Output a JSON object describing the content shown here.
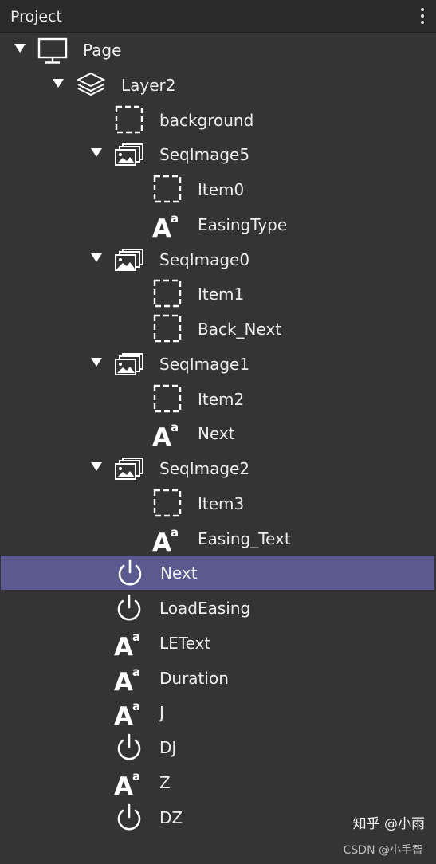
{
  "panel": {
    "title": "Project",
    "menu_icon": "more-vertical-icon"
  },
  "tree": [
    {
      "label": "Page",
      "icon": "monitor-icon",
      "depth": 0,
      "expanded": true
    },
    {
      "label": "Layer2",
      "icon": "layers-icon",
      "depth": 1,
      "expanded": true
    },
    {
      "label": "background",
      "icon": "dashed-box-icon",
      "depth": 2
    },
    {
      "label": "SeqImage5",
      "icon": "image-sequence-icon",
      "depth": 2,
      "expanded": true
    },
    {
      "label": "Item0",
      "icon": "dashed-box-icon",
      "depth": 3
    },
    {
      "label": "EasingType",
      "icon": "text-icon",
      "depth": 3
    },
    {
      "label": "SeqImage0",
      "icon": "image-sequence-icon",
      "depth": 2,
      "expanded": true
    },
    {
      "label": "Item1",
      "icon": "dashed-box-icon",
      "depth": 3
    },
    {
      "label": "Back_Next",
      "icon": "dashed-box-icon",
      "depth": 3
    },
    {
      "label": "SeqImage1",
      "icon": "image-sequence-icon",
      "depth": 2,
      "expanded": true
    },
    {
      "label": "Item2",
      "icon": "dashed-box-icon",
      "depth": 3
    },
    {
      "label": "Next",
      "icon": "text-icon",
      "depth": 3
    },
    {
      "label": "SeqImage2",
      "icon": "image-sequence-icon",
      "depth": 2,
      "expanded": true
    },
    {
      "label": "Item3",
      "icon": "dashed-box-icon",
      "depth": 3
    },
    {
      "label": "Easing_Text",
      "icon": "text-icon",
      "depth": 3
    },
    {
      "label": "Next",
      "icon": "power-icon",
      "depth": 2,
      "selected": true
    },
    {
      "label": "LoadEasing",
      "icon": "power-icon",
      "depth": 2
    },
    {
      "label": "LEText",
      "icon": "text-icon",
      "depth": 2
    },
    {
      "label": "Duration",
      "icon": "text-icon",
      "depth": 2
    },
    {
      "label": "J",
      "icon": "text-icon",
      "depth": 2
    },
    {
      "label": "DJ",
      "icon": "power-icon",
      "depth": 2
    },
    {
      "label": "Z",
      "icon": "text-icon",
      "depth": 2
    },
    {
      "label": "DZ",
      "icon": "power-icon",
      "depth": 2
    }
  ],
  "watermark": {
    "main": "知乎 @小雨",
    "sub": "CSDN @小手智"
  },
  "colors": {
    "background": "#343434",
    "header": "#2a2a2a",
    "selection": "#5b5a8f"
  }
}
